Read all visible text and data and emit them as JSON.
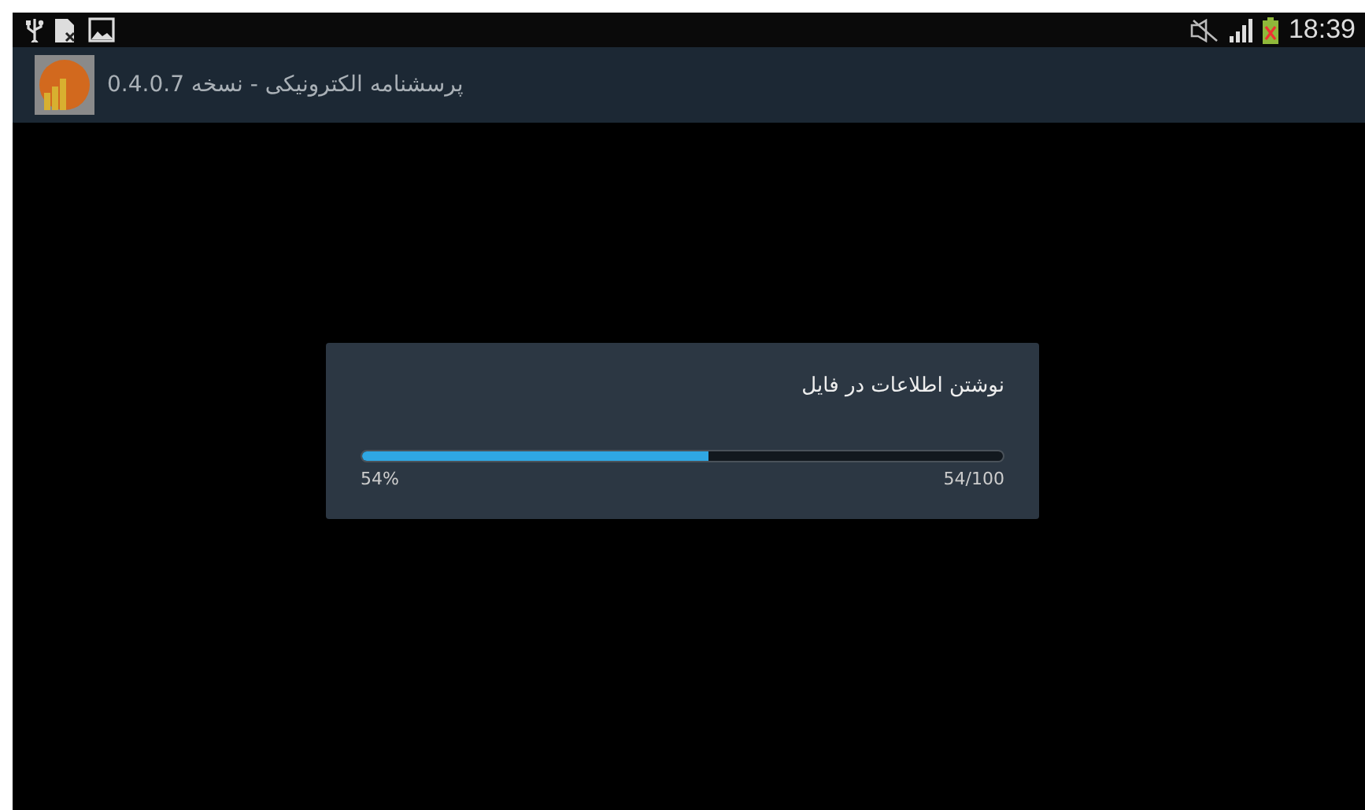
{
  "status_bar": {
    "time": "18:39"
  },
  "app_bar": {
    "title": "پرسشنامه الکترونیکی - نسخه 0.4.0.7"
  },
  "dialog": {
    "message": "نوشتن اطلاعات در فایل",
    "progress": {
      "level": 0.54,
      "percent": "54%",
      "count": "54/100"
    }
  }
}
